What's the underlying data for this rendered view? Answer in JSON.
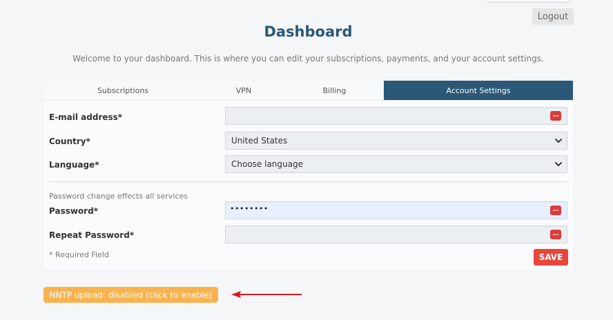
{
  "header": {
    "logout_label": "Logout",
    "title": "Dashboard",
    "subtitle": "Welcome to your dashboard. This is where you can edit your subscriptions, payments, and your account settings."
  },
  "tabs": [
    {
      "label": "Subscriptions",
      "active": false
    },
    {
      "label": "VPN",
      "active": false
    },
    {
      "label": "Billing",
      "active": false
    },
    {
      "label": "Account Settings",
      "active": true
    }
  ],
  "form": {
    "email": {
      "label": "E-mail address*",
      "value": ""
    },
    "country": {
      "label": "Country*",
      "value": "United States"
    },
    "language": {
      "label": "Language*",
      "value": "Choose language"
    },
    "password_hint": "Password change effects all services",
    "password": {
      "label": "Password*",
      "value": "••••••••"
    },
    "repeat_password": {
      "label": "Repeat Password*",
      "value": ""
    },
    "required_note": "* Required Field",
    "save_label": "SAVE"
  },
  "nntp": {
    "label": "NNTP upload: disabled (click to enable)"
  },
  "colors": {
    "primary": "#2b5876",
    "danger": "#e8453c",
    "warning": "#fbb24e",
    "key_icon": "#dc3b3b"
  },
  "icons": {
    "field_action": "password-manager-key-icon",
    "select": "chevron-down-icon",
    "pointer": "red-arrow-icon"
  }
}
